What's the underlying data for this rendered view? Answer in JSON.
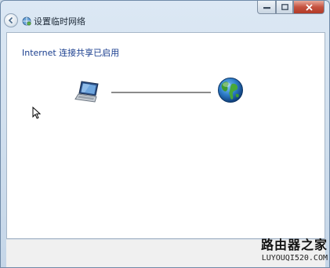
{
  "window": {
    "title": "设置临时网络"
  },
  "main": {
    "heading": "Internet 连接共享已启用"
  },
  "watermark": {
    "brand_cn": "路由器之家",
    "brand_url": "LUYOUQI520.COM"
  },
  "colors": {
    "heading": "#1a3e8f",
    "close_button": "#c5523f",
    "connection_line": "#8b8b8b"
  },
  "icons": {
    "back": "back-arrow-icon",
    "title": "network-icon",
    "device": "laptop-icon",
    "internet": "globe-icon"
  }
}
